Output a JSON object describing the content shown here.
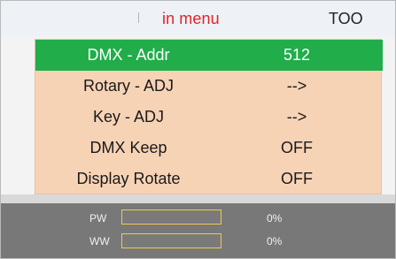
{
  "header": {
    "title": "in menu",
    "status": "TOO",
    "title_color": "#e2232a"
  },
  "menu": {
    "items": [
      {
        "label": "DMX - Addr",
        "value": "512",
        "selected": true
      },
      {
        "label": "Rotary - ADJ",
        "value": "-->",
        "selected": false
      },
      {
        "label": "Key  - ADJ",
        "value": "-->",
        "selected": false
      },
      {
        "label": "DMX Keep",
        "value": "OFF",
        "selected": false
      },
      {
        "label": "Display Rotate",
        "value": "OFF",
        "selected": false
      }
    ],
    "selected_color": "#20ad4a",
    "panel_color": "#f7d3b6"
  },
  "meters": [
    {
      "label": "PW",
      "value": "0%",
      "level": 0
    },
    {
      "label": "WW",
      "value": "0%",
      "level": 0
    }
  ]
}
